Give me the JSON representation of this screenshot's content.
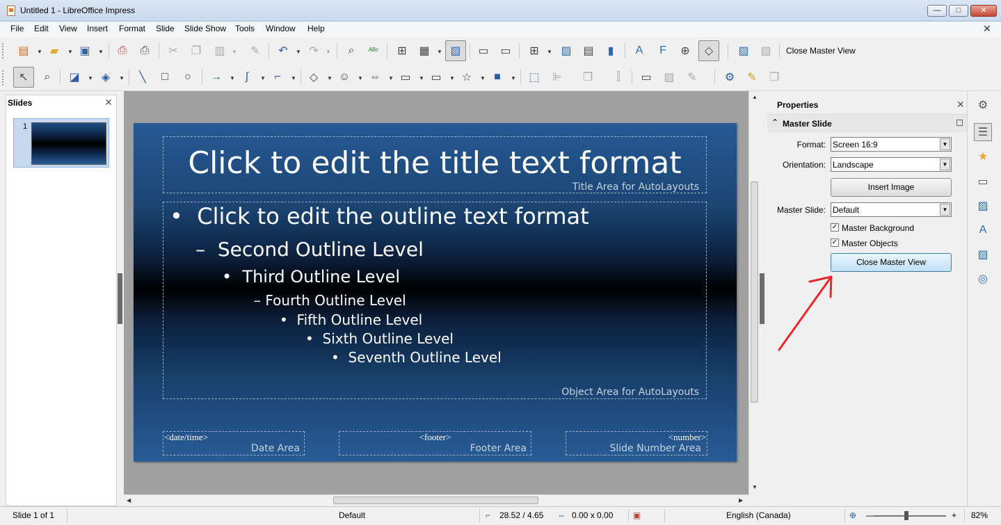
{
  "window": {
    "title": "Untitled 1 - LibreOffice Impress",
    "min": "—",
    "max": "□",
    "close": "✕"
  },
  "menu": [
    "File",
    "Edit",
    "View",
    "Insert",
    "Format",
    "Slide",
    "Slide Show",
    "Tools",
    "Window",
    "Help"
  ],
  "toolbar": {
    "close_master_view": "Close Master View"
  },
  "slides_pane": {
    "title": "Slides",
    "slide_number": "1"
  },
  "slide": {
    "title": "Click to edit the title text format",
    "title_area": "Title Area for AutoLayouts",
    "outline": [
      {
        "bullet": "•",
        "text": "Click to edit the outline text format"
      },
      {
        "bullet": "–",
        "text": "Second Outline Level"
      },
      {
        "bullet": "•",
        "text": "Third Outline Level"
      },
      {
        "bullet": "–",
        "text": "Fourth Outline Level"
      },
      {
        "bullet": "•",
        "text": "Fifth Outline Level"
      },
      {
        "bullet": "•",
        "text": "Sixth Outline Level"
      },
      {
        "bullet": "•",
        "text": "Seventh Outline Level"
      }
    ],
    "object_area": "Object Area for AutoLayouts",
    "date_field": "<date/time>",
    "date_area": "Date Area",
    "footer_field": "<footer>",
    "footer_area": "Footer Area",
    "number_field": "<number>",
    "number_area": "Slide Number Area"
  },
  "properties": {
    "title": "Properties",
    "section": "Master Slide",
    "format_label": "Format:",
    "format_value": "Screen 16:9",
    "orientation_label": "Orientation:",
    "orientation_value": "Landscape",
    "insert_image": "Insert Image",
    "master_slide_label": "Master Slide:",
    "master_slide_value": "Default",
    "master_background": "Master Background",
    "master_background_checked": true,
    "master_objects": "Master Objects",
    "master_objects_checked": true,
    "close_master_view": "Close Master View"
  },
  "status": {
    "slide": "Slide 1 of 1",
    "master": "Default",
    "position": "28.52 / 4.65",
    "size": "0.00 x 0.00",
    "language": "English (Canada)",
    "zoom": "82%"
  },
  "colors": {
    "annotation_arrow": "#e8262c",
    "selection": "#c6d8ee"
  }
}
